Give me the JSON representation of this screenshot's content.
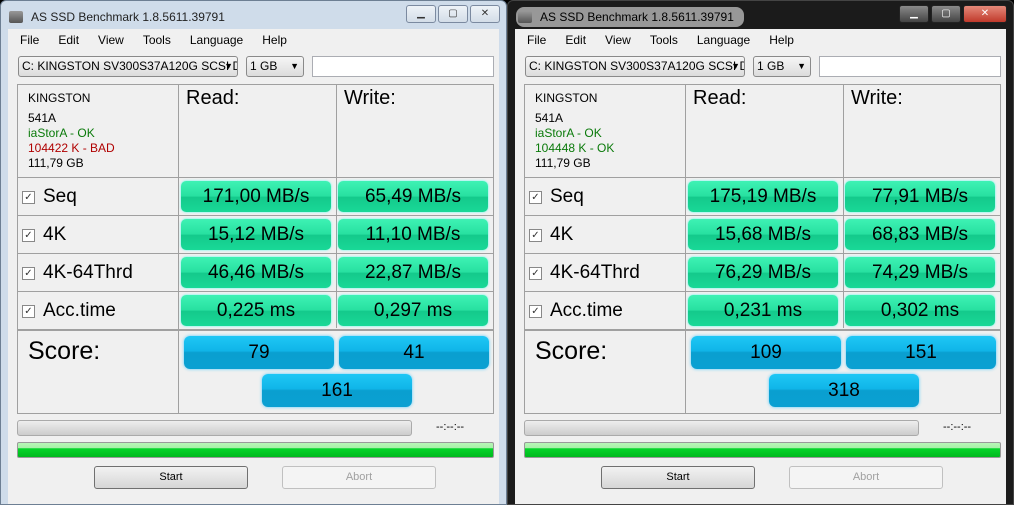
{
  "windows": [
    {
      "title": "AS SSD Benchmark 1.8.5611.39791",
      "menu": [
        "File",
        "Edit",
        "View",
        "Tools",
        "Language",
        "Help"
      ],
      "drive": "C: KINGSTON SV300S37A120G SCSI Di:",
      "size": "1 GB",
      "text_value": "",
      "info": {
        "model": "KINGSTON",
        "firmware": "541A",
        "driver": "iaStorA - OK",
        "alignment": "104422 K - BAD",
        "alignment_status": "bad",
        "capacity": "111,79 GB"
      },
      "read_header": "Read:",
      "write_header": "Write:",
      "rows": [
        {
          "label": "Seq",
          "checked": true,
          "read": "171,00 MB/s",
          "write": "65,49 MB/s"
        },
        {
          "label": "4K",
          "checked": true,
          "read": "15,12 MB/s",
          "write": "11,10 MB/s"
        },
        {
          "label": "4K-64Thrd",
          "checked": true,
          "read": "46,46 MB/s",
          "write": "22,87 MB/s"
        },
        {
          "label": "Acc.time",
          "checked": true,
          "read": "0,225 ms",
          "write": "0,297 ms"
        }
      ],
      "score_label": "Score:",
      "score_read": "79",
      "score_write": "41",
      "score_total": "161",
      "time": "--:--:--",
      "progress": 0,
      "overall_progress": 100,
      "start": "Start",
      "abort": "Abort"
    },
    {
      "title": "AS SSD Benchmark 1.8.5611.39791",
      "menu": [
        "File",
        "Edit",
        "View",
        "Tools",
        "Language",
        "Help"
      ],
      "drive": "C: KINGSTON SV300S37A120G SCSI Di:",
      "size": "1 GB",
      "text_value": "",
      "info": {
        "model": "KINGSTON",
        "firmware": "541A",
        "driver": "iaStorA - OK",
        "alignment": "104448 K - OK",
        "alignment_status": "ok",
        "capacity": "111,79 GB"
      },
      "read_header": "Read:",
      "write_header": "Write:",
      "rows": [
        {
          "label": "Seq",
          "checked": true,
          "read": "175,19 MB/s",
          "write": "77,91 MB/s"
        },
        {
          "label": "4K",
          "checked": true,
          "read": "15,68 MB/s",
          "write": "68,83 MB/s"
        },
        {
          "label": "4K-64Thrd",
          "checked": true,
          "read": "76,29 MB/s",
          "write": "74,29 MB/s"
        },
        {
          "label": "Acc.time",
          "checked": true,
          "read": "0,231 ms",
          "write": "0,302 ms"
        }
      ],
      "score_label": "Score:",
      "score_read": "109",
      "score_write": "151",
      "score_total": "318",
      "time": "--:--:--",
      "progress": 0,
      "overall_progress": 100,
      "start": "Start",
      "abort": "Abort"
    }
  ]
}
